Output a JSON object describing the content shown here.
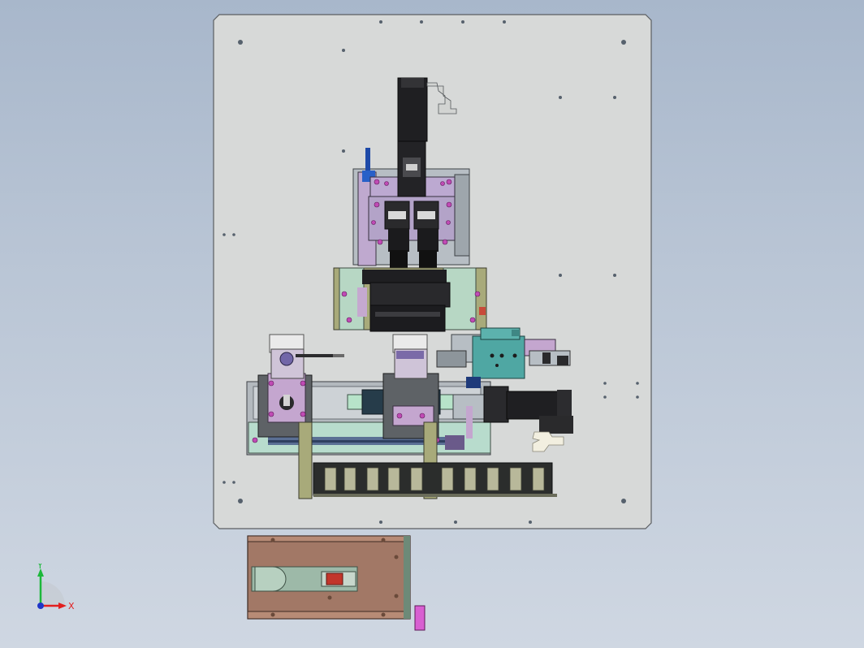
{
  "app": {
    "window_title": ""
  },
  "viewport": {
    "background_top": "#a8b7cb",
    "background_bottom": "#cfd7e2"
  },
  "colors": {
    "base_plate": "#d7d9d8",
    "base_plate_edge": "#5b5e61",
    "motor_black": "#1c1c1e",
    "machined_steel": "#a7b2b8",
    "lilac_fixture": "#b9a6c8",
    "magenta_detail": "#c04bb5",
    "olive_green": "#a8aa7a",
    "mint_green": "#b7d7c4",
    "teal_block": "#4fa7a3",
    "drag_chain_dark": "#2b2d2c",
    "rust_panel": "#a27866",
    "red_part": "#c2362b",
    "pink_tab": "#d85fd1"
  },
  "triad": {
    "x_label": "X",
    "y_label": "Y",
    "x_color": "#e21f1f",
    "y_color": "#1cb83a",
    "z_color": "#1e36c8"
  },
  "parts": {
    "upper_motor": "servo-motor",
    "upper_assembly": "press-head-assembly",
    "left_station": "left-fixture-station",
    "center_station": "center-fixture-station",
    "right_gripper": "gripper-cylinder-assembly",
    "right_motor": "linear-axis-motor",
    "rail": "linear-rail",
    "drag_chain": "cable-drag-chain",
    "lower_panel": "bottom-view-panel"
  }
}
